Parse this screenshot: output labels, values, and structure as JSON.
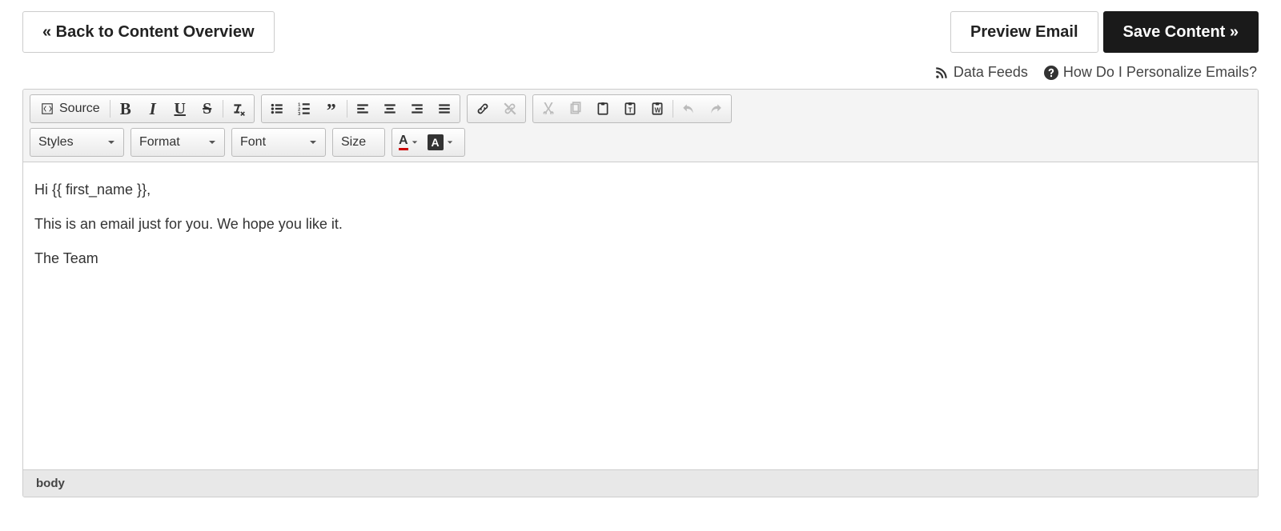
{
  "header": {
    "back_label": "« Back to Content Overview",
    "preview_label": "Preview Email",
    "save_label": "Save Content »"
  },
  "links": {
    "data_feeds": "Data Feeds",
    "personalize": "How Do I Personalize Emails?"
  },
  "toolbar": {
    "source_label": "Source",
    "styles": "Styles",
    "format": "Format",
    "font": "Font",
    "size": "Size"
  },
  "content": {
    "line1": "Hi {{ first_name }},",
    "line2": "This is an email just for you. We hope you like it.",
    "line3": "The Team"
  },
  "status": {
    "path": "body"
  }
}
